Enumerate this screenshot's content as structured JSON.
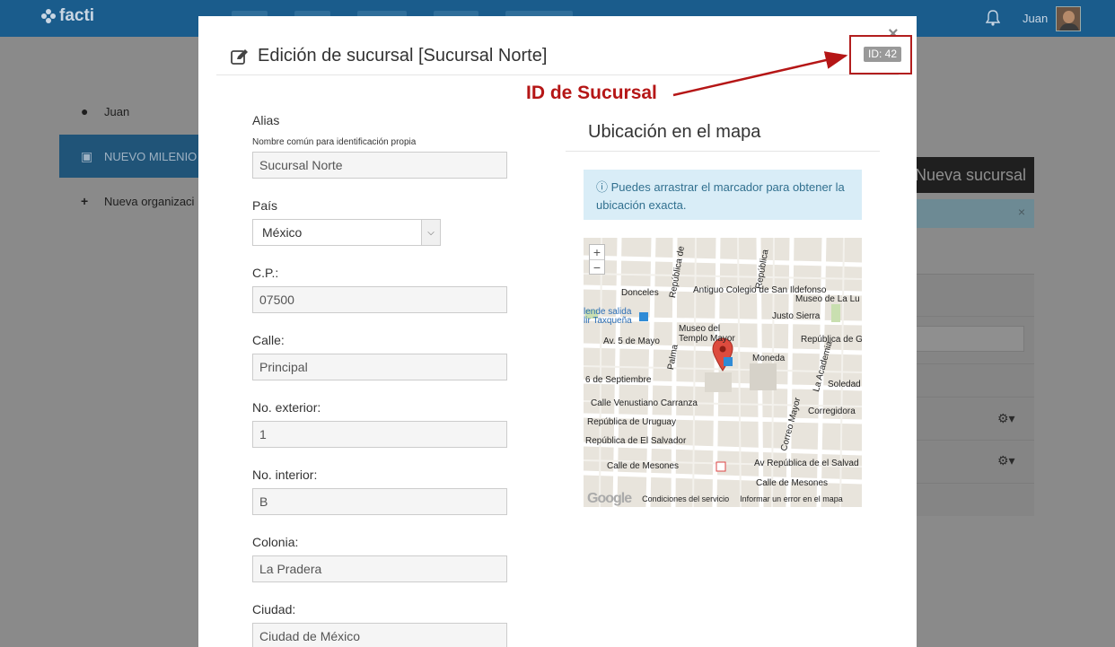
{
  "app": {
    "logo_text": "facti",
    "user_name": "Juan"
  },
  "sidebar": {
    "items": [
      {
        "label": "Juan",
        "icon": "user-icon"
      },
      {
        "label": "NUEVO MILENIO A",
        "icon": "building-icon"
      },
      {
        "label": "Nueva organizaci",
        "icon": "plus-icon"
      }
    ]
  },
  "background": {
    "new_branch_button": "Nueva sucursal",
    "alert_close": "×"
  },
  "modal": {
    "title": "Edición de sucursal [Sucursal Norte]",
    "close_label": "×",
    "id_badge": "ID: 42",
    "annotation": "ID de Sucursal",
    "fields": {
      "alias": {
        "label": "Alias",
        "help": "Nombre común para identificación propia",
        "value": "Sucursal Norte"
      },
      "pais": {
        "label": "País",
        "value": "México"
      },
      "cp": {
        "label": "C.P.:",
        "value": "07500"
      },
      "calle": {
        "label": "Calle:",
        "value": "Principal"
      },
      "no_exterior": {
        "label": "No. exterior:",
        "value": "1"
      },
      "no_interior": {
        "label": "No. interior:",
        "value": "B"
      },
      "colonia": {
        "label": "Colonia:",
        "value": "La Pradera"
      },
      "ciudad": {
        "label": "Ciudad:",
        "value": "Ciudad de México"
      }
    },
    "map": {
      "heading": "Ubicación en el mapa",
      "info": "Puedes arrastrar el marcador para obtener la ubicación exacta.",
      "zoom_in": "+",
      "zoom_out": "−",
      "google_logo": "Google",
      "terms": "Condiciones del servicio",
      "report": "Informar un error en el mapa",
      "labels": [
        "Donceles",
        "Antiguo Colegio de San Ildefonso",
        "Museo de La Lu",
        "Justo Sierra",
        "Museo del Templo Mayor",
        "Av. 5 de Mayo",
        "República de G",
        "Moneda",
        "6 de Septiembre",
        "Soledad",
        "Calle Venustiano Carranza",
        "Corregidora",
        "República de Uruguay",
        "República de El Salvador",
        "Calle de Mesones",
        "Av República de el Salvad",
        "Calle de Mesones",
        "Palma",
        "Correo Mayor",
        "La Academia",
        "República de",
        "República",
        "lende salida",
        "lir Taxqueña"
      ]
    }
  }
}
